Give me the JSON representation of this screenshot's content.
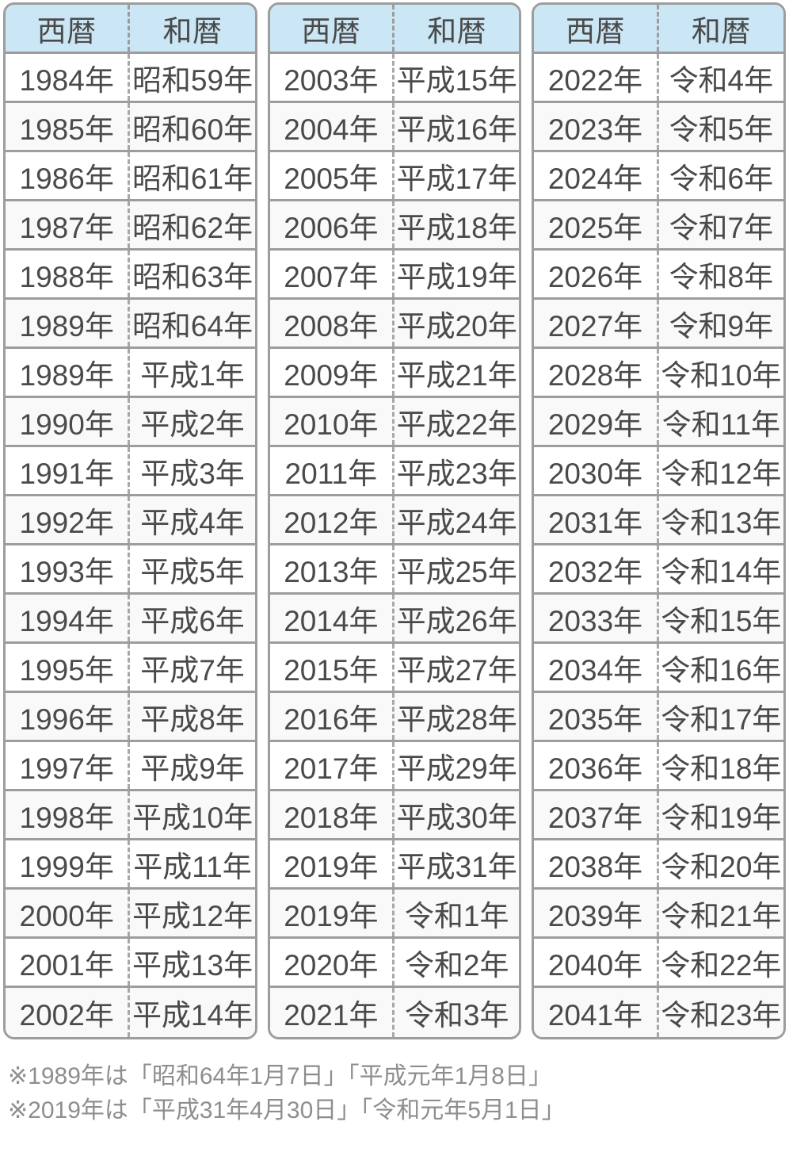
{
  "table_header": {
    "western_label": "西暦",
    "japanese_label": "和暦"
  },
  "colors": {
    "header_background": "#cbe7f5",
    "border": "#9d9d9d",
    "text": "#4a4a4a",
    "row_background": "#ffffff",
    "row_background_alt": "#f9f9f9",
    "note_text": "#8e8e8e"
  },
  "tables": [
    {
      "rows": [
        {
          "western": "1984年",
          "japanese": "昭和59年"
        },
        {
          "western": "1985年",
          "japanese": "昭和60年"
        },
        {
          "western": "1986年",
          "japanese": "昭和61年"
        },
        {
          "western": "1987年",
          "japanese": "昭和62年"
        },
        {
          "western": "1988年",
          "japanese": "昭和63年"
        },
        {
          "western": "1989年",
          "japanese": "昭和64年"
        },
        {
          "western": "1989年",
          "japanese": "平成1年"
        },
        {
          "western": "1990年",
          "japanese": "平成2年"
        },
        {
          "western": "1991年",
          "japanese": "平成3年"
        },
        {
          "western": "1992年",
          "japanese": "平成4年"
        },
        {
          "western": "1993年",
          "japanese": "平成5年"
        },
        {
          "western": "1994年",
          "japanese": "平成6年"
        },
        {
          "western": "1995年",
          "japanese": "平成7年"
        },
        {
          "western": "1996年",
          "japanese": "平成8年"
        },
        {
          "western": "1997年",
          "japanese": "平成9年"
        },
        {
          "western": "1998年",
          "japanese": "平成10年"
        },
        {
          "western": "1999年",
          "japanese": "平成11年"
        },
        {
          "western": "2000年",
          "japanese": "平成12年"
        },
        {
          "western": "2001年",
          "japanese": "平成13年"
        },
        {
          "western": "2002年",
          "japanese": "平成14年"
        }
      ]
    },
    {
      "rows": [
        {
          "western": "2003年",
          "japanese": "平成15年"
        },
        {
          "western": "2004年",
          "japanese": "平成16年"
        },
        {
          "western": "2005年",
          "japanese": "平成17年"
        },
        {
          "western": "2006年",
          "japanese": "平成18年"
        },
        {
          "western": "2007年",
          "japanese": "平成19年"
        },
        {
          "western": "2008年",
          "japanese": "平成20年"
        },
        {
          "western": "2009年",
          "japanese": "平成21年"
        },
        {
          "western": "2010年",
          "japanese": "平成22年"
        },
        {
          "western": "2011年",
          "japanese": "平成23年"
        },
        {
          "western": "2012年",
          "japanese": "平成24年"
        },
        {
          "western": "2013年",
          "japanese": "平成25年"
        },
        {
          "western": "2014年",
          "japanese": "平成26年"
        },
        {
          "western": "2015年",
          "japanese": "平成27年"
        },
        {
          "western": "2016年",
          "japanese": "平成28年"
        },
        {
          "western": "2017年",
          "japanese": "平成29年"
        },
        {
          "western": "2018年",
          "japanese": "平成30年"
        },
        {
          "western": "2019年",
          "japanese": "平成31年"
        },
        {
          "western": "2019年",
          "japanese": "令和1年"
        },
        {
          "western": "2020年",
          "japanese": "令和2年"
        },
        {
          "western": "2021年",
          "japanese": "令和3年"
        }
      ]
    },
    {
      "rows": [
        {
          "western": "2022年",
          "japanese": "令和4年"
        },
        {
          "western": "2023年",
          "japanese": "令和5年"
        },
        {
          "western": "2024年",
          "japanese": "令和6年"
        },
        {
          "western": "2025年",
          "japanese": "令和7年"
        },
        {
          "western": "2026年",
          "japanese": "令和8年"
        },
        {
          "western": "2027年",
          "japanese": "令和9年"
        },
        {
          "western": "2028年",
          "japanese": "令和10年"
        },
        {
          "western": "2029年",
          "japanese": "令和11年"
        },
        {
          "western": "2030年",
          "japanese": "令和12年"
        },
        {
          "western": "2031年",
          "japanese": "令和13年"
        },
        {
          "western": "2032年",
          "japanese": "令和14年"
        },
        {
          "western": "2033年",
          "japanese": "令和15年"
        },
        {
          "western": "2034年",
          "japanese": "令和16年"
        },
        {
          "western": "2035年",
          "japanese": "令和17年"
        },
        {
          "western": "2036年",
          "japanese": "令和18年"
        },
        {
          "western": "2037年",
          "japanese": "令和19年"
        },
        {
          "western": "2038年",
          "japanese": "令和20年"
        },
        {
          "western": "2039年",
          "japanese": "令和21年"
        },
        {
          "western": "2040年",
          "japanese": "令和22年"
        },
        {
          "western": "2041年",
          "japanese": "令和23年"
        }
      ]
    }
  ],
  "notes": [
    "※1989年は「昭和64年1月7日」「平成元年1月8日」",
    "※2019年は「平成31年4月30日」「令和元年5月1日」"
  ]
}
